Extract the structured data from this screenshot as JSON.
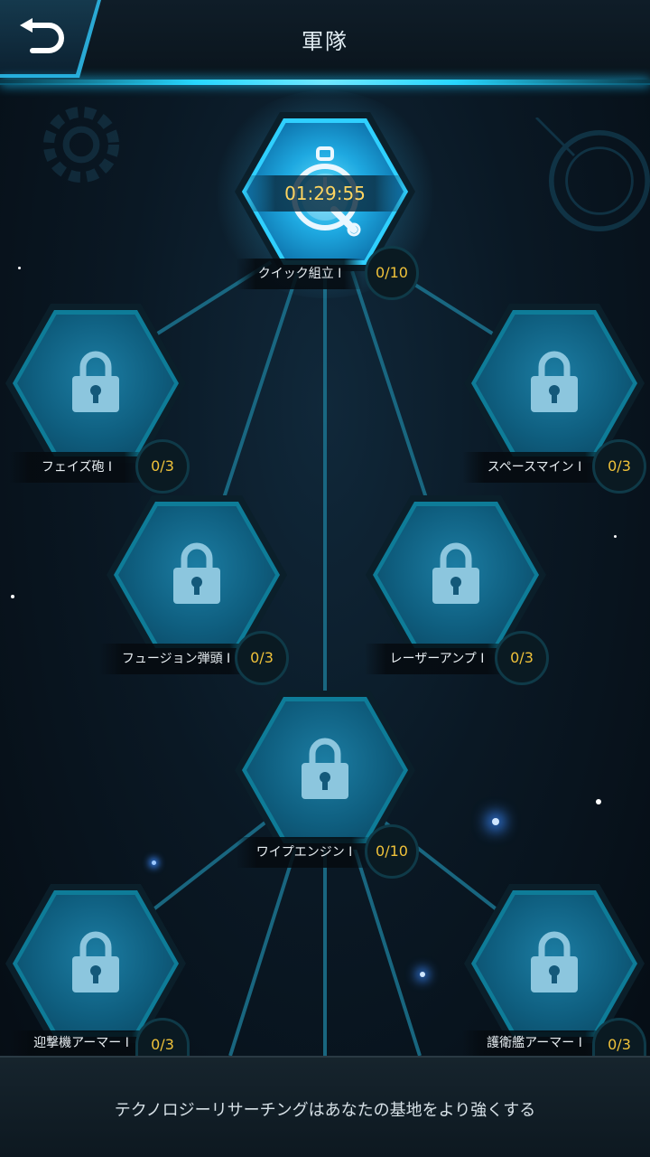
{
  "header": {
    "title": "軍隊",
    "back_icon": "back-arrow-icon"
  },
  "active_research": {
    "timer": "01:29:55",
    "icon": "stopwatch-wrench-icon"
  },
  "nodes": [
    {
      "id": "quick-assembly",
      "label": "クイック組立 I",
      "progress": "0/10",
      "locked": false
    },
    {
      "id": "phase-cannon",
      "label": "フェイズ砲 I",
      "progress": "0/3",
      "locked": true
    },
    {
      "id": "space-mine",
      "label": "スペースマイン I",
      "progress": "0/3",
      "locked": true
    },
    {
      "id": "fusion-warhead",
      "label": "フュージョン弾頭 I",
      "progress": "0/3",
      "locked": true
    },
    {
      "id": "laser-amp",
      "label": "レーザーアンプ I",
      "progress": "0/3",
      "locked": true
    },
    {
      "id": "warp-engine",
      "label": "ワイプエンジン I",
      "progress": "0/10",
      "locked": true
    },
    {
      "id": "interceptor-armor",
      "label": "迎撃機アーマー I",
      "progress": "0/3",
      "locked": true
    },
    {
      "id": "escort-armor",
      "label": "護衛艦アーマー I",
      "progress": "0/3",
      "locked": true
    }
  ],
  "footer": {
    "text": "テクノロジーリサーチングはあなたの基地をより強くする"
  },
  "colors": {
    "accent": "#2fd0ff",
    "progress_text": "#f0c23a",
    "hex_fill": "#0f5f80"
  }
}
